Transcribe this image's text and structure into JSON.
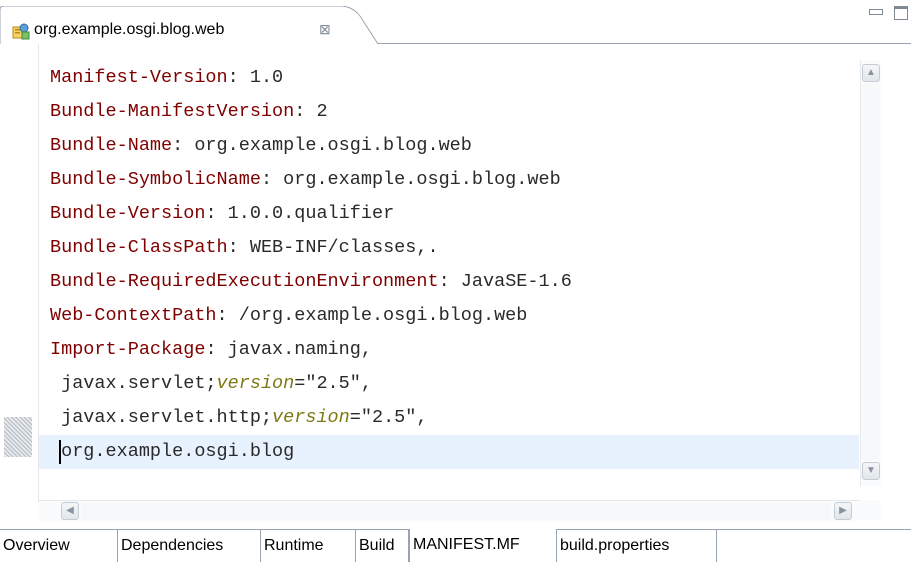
{
  "editor_tab": {
    "title": "org.example.osgi.blog.web",
    "close_glyph": "⊠",
    "icon": "plugin-manifest-icon"
  },
  "view_controls": {
    "minimize_icon": "minimize-icon",
    "maximize_icon": "maximize-icon"
  },
  "code_lines": [
    [
      {
        "k": "key",
        "t": "Manifest-Version"
      },
      {
        "k": "plain",
        "t": ": 1.0"
      }
    ],
    [
      {
        "k": "key",
        "t": "Bundle-ManifestVersion"
      },
      {
        "k": "plain",
        "t": ": 2"
      }
    ],
    [
      {
        "k": "key",
        "t": "Bundle-Name"
      },
      {
        "k": "plain",
        "t": ": org.example.osgi.blog.web"
      }
    ],
    [
      {
        "k": "key",
        "t": "Bundle-SymbolicName"
      },
      {
        "k": "plain",
        "t": ": org.example.osgi.blog.web"
      }
    ],
    [
      {
        "k": "key",
        "t": "Bundle-Version"
      },
      {
        "k": "plain",
        "t": ": 1.0.0.qualifier"
      }
    ],
    [
      {
        "k": "key",
        "t": "Bundle-ClassPath"
      },
      {
        "k": "plain",
        "t": ": WEB-INF/classes,."
      }
    ],
    [
      {
        "k": "key",
        "t": "Bundle-RequiredExecutionEnvironment"
      },
      {
        "k": "plain",
        "t": ": JavaSE-1.6"
      }
    ],
    [
      {
        "k": "key",
        "t": "Web-ContextPath"
      },
      {
        "k": "plain",
        "t": ": /org.example.osgi.blog.web"
      }
    ],
    [
      {
        "k": "key",
        "t": "Import-Package"
      },
      {
        "k": "plain",
        "t": ": javax.naming,"
      }
    ],
    [
      {
        "k": "plain",
        "t": " javax.servlet;"
      },
      {
        "k": "attr",
        "t": "version"
      },
      {
        "k": "plain",
        "t": "=\"2.5\","
      }
    ],
    [
      {
        "k": "plain",
        "t": " javax.servlet.http;"
      },
      {
        "k": "attr",
        "t": "version"
      },
      {
        "k": "plain",
        "t": "=\"2.5\","
      }
    ],
    [
      {
        "k": "plain",
        "t": " org.example.osgi.blog"
      }
    ]
  ],
  "colors": {
    "key": "#7f0000",
    "attr": "#7e7a13",
    "plain": "#2a2a2a",
    "current_line": "#e8f2fe"
  },
  "scrollbars": {
    "up_glyph": "▲",
    "down_glyph": "▼",
    "left_glyph": "◀",
    "right_glyph": "▶"
  },
  "bottom_tabs": [
    {
      "label": "Overview",
      "active": false
    },
    {
      "label": "Dependencies",
      "active": false
    },
    {
      "label": "Runtime",
      "active": false
    },
    {
      "label": "Build",
      "active": false
    },
    {
      "label": "MANIFEST.MF",
      "active": true
    },
    {
      "label": "build.properties",
      "active": false
    }
  ]
}
